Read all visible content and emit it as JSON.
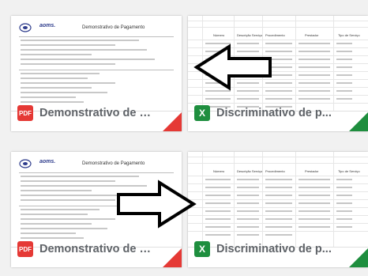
{
  "cards": [
    {
      "id": "demo-top",
      "file_type": "PDF",
      "file_name": "Demonstrativo de p...",
      "preview_title": "Demonstrativo de Pagamento",
      "preview_logo": "aoms.",
      "accent": "#e53935"
    },
    {
      "id": "disc-top",
      "file_type": "X",
      "file_name": "Discriminativo de p...",
      "preview_headers": [
        "Número",
        "Descrição Serviço",
        "Procedimento",
        "Prestador",
        "Tipo de Serviço"
      ],
      "accent": "#1e8e3e"
    },
    {
      "id": "demo-bottom",
      "file_type": "PDF",
      "file_name": "Demonstrativo de p...",
      "preview_title": "Demonstrativo de Pagamento",
      "preview_logo": "aoms.",
      "accent": "#e53935"
    },
    {
      "id": "disc-bottom",
      "file_type": "X",
      "file_name": "Discriminativo de p...",
      "preview_headers": [
        "Número",
        "Descrição Serviço",
        "Procedimento",
        "Prestador",
        "Tipo de Serviço"
      ],
      "accent": "#1e8e3e"
    }
  ],
  "icons": {
    "pdf": "pdf-file-icon",
    "xls": "excel-file-icon",
    "arrow_left": "arrow-left-icon",
    "arrow_right": "arrow-right-icon"
  },
  "colors": {
    "pdf_red": "#e53935",
    "excel_green": "#1e8e3e",
    "background": "#f1f1f1"
  }
}
